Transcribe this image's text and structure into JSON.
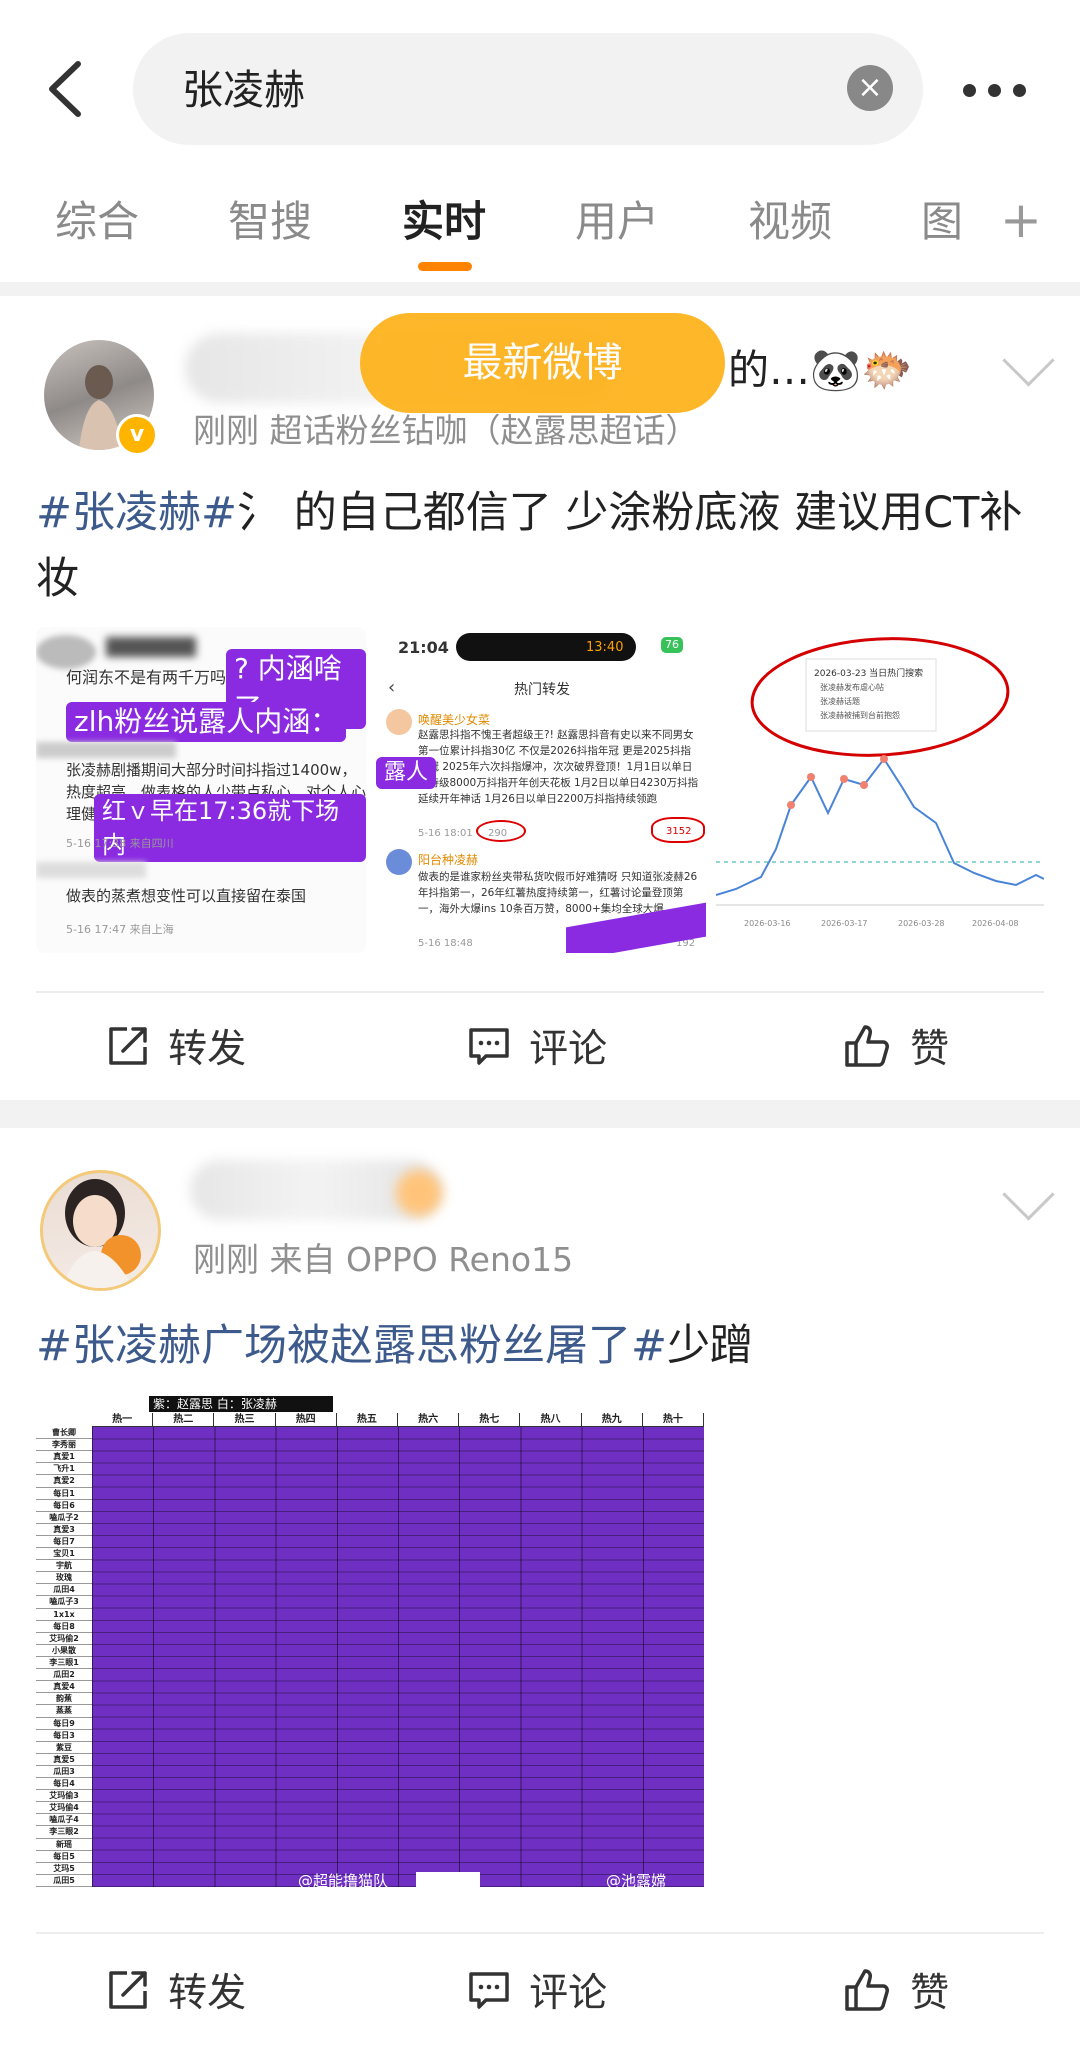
{
  "header": {
    "search_value": "张凌赫",
    "clear_glyph": "×"
  },
  "tabs": [
    "综合",
    "智搜",
    "实时",
    "用户",
    "视频",
    "图"
  ],
  "tab_plus": "+",
  "new_weibo_pill": "最新微博",
  "post1": {
    "name_suffix": "的…🐼🐡",
    "meta": "刚刚  超话粉丝钻咖（赵露思超话）",
    "tag": "#张凌赫#",
    "text_tail": "氵 的自己都信了 少涂粉底液 建议用CT补妆",
    "thumb1": {
      "line1": "何润东不是有两千万吗?",
      "label1": "? 内涵啥了",
      "label2": "zlh粉丝说露人内涵：",
      "para": "张凌赫剧播期间大部分时间抖指过1400w，热度超高，做表格的人少带点私心，对个人心理健康比较好",
      "label3": "红ｖ早在17:36就下场内",
      "time1": "5-16 17:38  来自四川",
      "line2": "做表的蒸煮想变性可以直接留在泰国",
      "time2": "5-16 17:47  来自上海"
    },
    "thumb2": {
      "clock": "21:04",
      "island": "13:40",
      "battery": "76",
      "title": "热门转发",
      "user1": "唤醒美少女菜",
      "text1": "赵露思抖指不愧王者超级王?! 赵露思抖音有史以来不同男女第一位累计抖指30亿 不仅是2026抖指年冠 更是2025抖指年冠 2025年六次抖指爆冲，次次破界登顶！1月1日以单日史诗级8000万抖指开年创天花板 1月2日以单日4230万抖指延续开年神话 1月26日以单日2200万抖指持续领跑",
      "label": "露人",
      "time": "5-16 18:01",
      "count1": "290",
      "count2": "3152",
      "user2": "阳台种凌赫",
      "text2": "做表的是谁家粉丝夹带私货吹假币好难猜呀 只知道张凌赫26年抖指第一，26年红薯热度持续第一，红薯讨论量登顶第一，海外大爆ins 10条百万赞，8000+集均全球大爆.....",
      "time2": "5-16 18:48",
      "count3": "192"
    },
    "thumb3": {
      "title": "2026-03-23 当日热门搜索",
      "items": [
        "张凌赫发布虐心帖",
        "张凌赫话题",
        "张凌赫被捕到台前抱怨"
      ],
      "xticks": [
        "2026-03-16",
        "2026-03-17",
        "2026-03-28",
        "2026-04-08"
      ]
    }
  },
  "post2": {
    "meta": "刚刚  来自 OPPO Reno15",
    "tag": "#张凌赫广场被赵露思粉丝屠了#",
    "text_tail": "少蹭",
    "sheet": {
      "title": "紫：赵露思 白：张凌赫",
      "cols": [
        "热一",
        "热二",
        "热三",
        "热四",
        "热五",
        "热六",
        "热七",
        "热八",
        "热九",
        "热十"
      ],
      "rows": [
        "曹长卿",
        "李秀丽",
        "真爱1",
        "飞升1",
        "真爱2",
        "每日1",
        "每日6",
        "嗑瓜子2",
        "真爱3",
        "每日7",
        "宝贝1",
        "宇航",
        "玫瑰",
        "瓜田4",
        "嗑瓜子3",
        "1x1x",
        "每日8",
        "艾玛偷2",
        "小果散",
        "李三眼1",
        "瓜田2",
        "真爱4",
        "韵蕉",
        "蒸蒸",
        "每日9",
        "每日3",
        "紫豆",
        "真爱5",
        "瓜田3",
        "每日4",
        "艾玛偷3",
        "艾玛偷4",
        "嗑瓜子4",
        "李三眼2",
        "新瑶",
        "每日5",
        "艾玛5",
        "瓜田5"
      ],
      "wm1": "@超能撸猫队",
      "wm2": "@池露嫦"
    }
  },
  "actions": {
    "repost": "转发",
    "comment": "评论",
    "like": "赞"
  },
  "colors": {
    "accent": "#ff8200",
    "tag": "#3c5a8c",
    "purple": "#7a33c9"
  }
}
